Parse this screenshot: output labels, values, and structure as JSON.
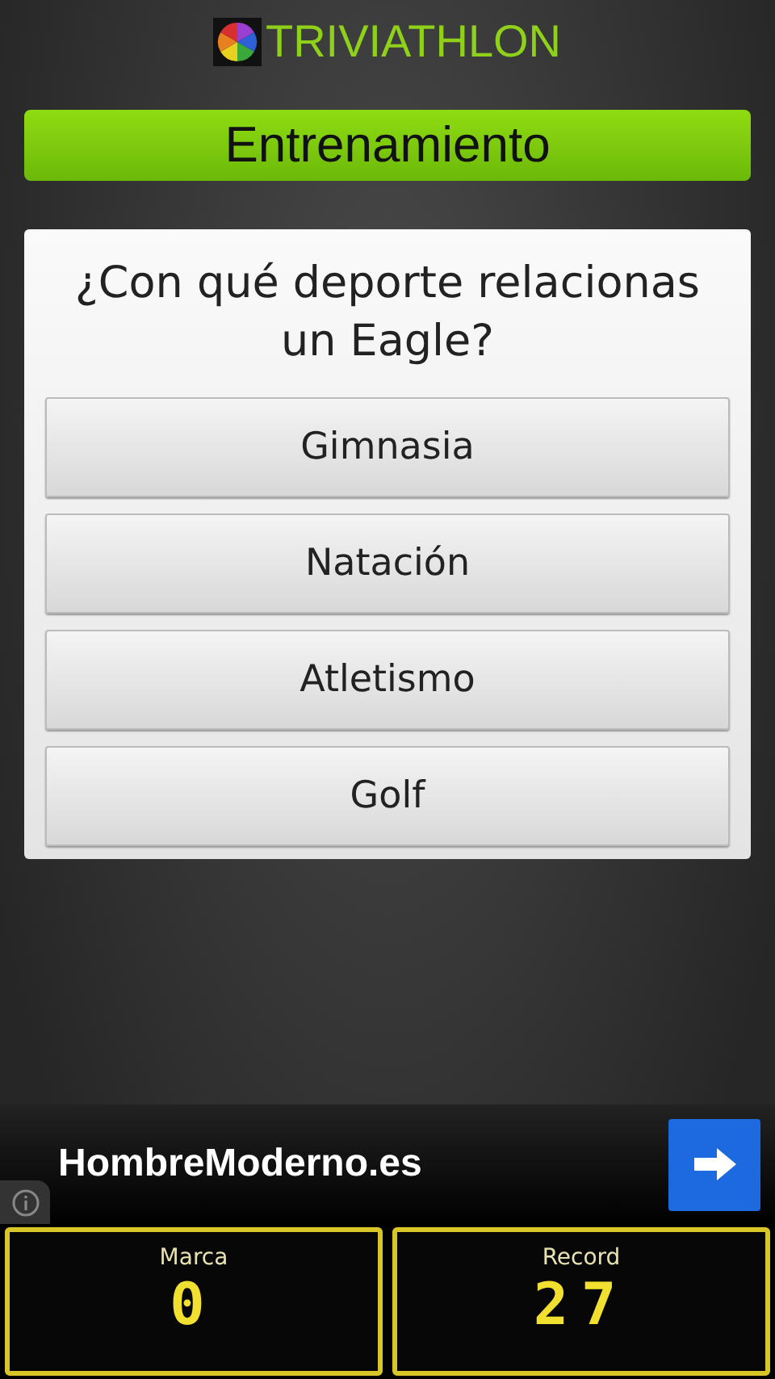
{
  "app_title": "TRIVIATHLON",
  "mode": "Entrenamiento",
  "question": "¿Con qué deporte relacionas un Eagle?",
  "answers": [
    "Gimnasia",
    "Natación",
    "Atletismo",
    "Golf"
  ],
  "ad": {
    "text": "HombreModerno.es"
  },
  "scores": [
    {
      "label": "Marca",
      "value": "0"
    },
    {
      "label": "Record",
      "value": "27"
    }
  ]
}
